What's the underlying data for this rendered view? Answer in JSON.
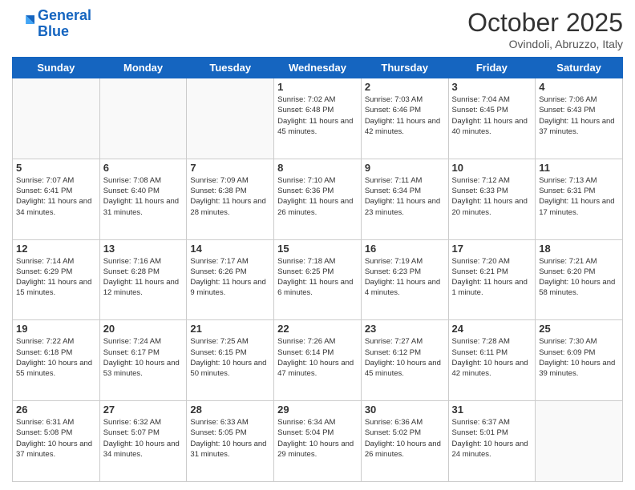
{
  "header": {
    "logo_general": "General",
    "logo_blue": "Blue",
    "month": "October 2025",
    "location": "Ovindoli, Abruzzo, Italy"
  },
  "days_of_week": [
    "Sunday",
    "Monday",
    "Tuesday",
    "Wednesday",
    "Thursday",
    "Friday",
    "Saturday"
  ],
  "weeks": [
    [
      {
        "day": "",
        "sunrise": "",
        "sunset": "",
        "daylight": ""
      },
      {
        "day": "",
        "sunrise": "",
        "sunset": "",
        "daylight": ""
      },
      {
        "day": "",
        "sunrise": "",
        "sunset": "",
        "daylight": ""
      },
      {
        "day": "1",
        "sunrise": "Sunrise: 7:02 AM",
        "sunset": "Sunset: 6:48 PM",
        "daylight": "Daylight: 11 hours and 45 minutes."
      },
      {
        "day": "2",
        "sunrise": "Sunrise: 7:03 AM",
        "sunset": "Sunset: 6:46 PM",
        "daylight": "Daylight: 11 hours and 42 minutes."
      },
      {
        "day": "3",
        "sunrise": "Sunrise: 7:04 AM",
        "sunset": "Sunset: 6:45 PM",
        "daylight": "Daylight: 11 hours and 40 minutes."
      },
      {
        "day": "4",
        "sunrise": "Sunrise: 7:06 AM",
        "sunset": "Sunset: 6:43 PM",
        "daylight": "Daylight: 11 hours and 37 minutes."
      }
    ],
    [
      {
        "day": "5",
        "sunrise": "Sunrise: 7:07 AM",
        "sunset": "Sunset: 6:41 PM",
        "daylight": "Daylight: 11 hours and 34 minutes."
      },
      {
        "day": "6",
        "sunrise": "Sunrise: 7:08 AM",
        "sunset": "Sunset: 6:40 PM",
        "daylight": "Daylight: 11 hours and 31 minutes."
      },
      {
        "day": "7",
        "sunrise": "Sunrise: 7:09 AM",
        "sunset": "Sunset: 6:38 PM",
        "daylight": "Daylight: 11 hours and 28 minutes."
      },
      {
        "day": "8",
        "sunrise": "Sunrise: 7:10 AM",
        "sunset": "Sunset: 6:36 PM",
        "daylight": "Daylight: 11 hours and 26 minutes."
      },
      {
        "day": "9",
        "sunrise": "Sunrise: 7:11 AM",
        "sunset": "Sunset: 6:34 PM",
        "daylight": "Daylight: 11 hours and 23 minutes."
      },
      {
        "day": "10",
        "sunrise": "Sunrise: 7:12 AM",
        "sunset": "Sunset: 6:33 PM",
        "daylight": "Daylight: 11 hours and 20 minutes."
      },
      {
        "day": "11",
        "sunrise": "Sunrise: 7:13 AM",
        "sunset": "Sunset: 6:31 PM",
        "daylight": "Daylight: 11 hours and 17 minutes."
      }
    ],
    [
      {
        "day": "12",
        "sunrise": "Sunrise: 7:14 AM",
        "sunset": "Sunset: 6:29 PM",
        "daylight": "Daylight: 11 hours and 15 minutes."
      },
      {
        "day": "13",
        "sunrise": "Sunrise: 7:16 AM",
        "sunset": "Sunset: 6:28 PM",
        "daylight": "Daylight: 11 hours and 12 minutes."
      },
      {
        "day": "14",
        "sunrise": "Sunrise: 7:17 AM",
        "sunset": "Sunset: 6:26 PM",
        "daylight": "Daylight: 11 hours and 9 minutes."
      },
      {
        "day": "15",
        "sunrise": "Sunrise: 7:18 AM",
        "sunset": "Sunset: 6:25 PM",
        "daylight": "Daylight: 11 hours and 6 minutes."
      },
      {
        "day": "16",
        "sunrise": "Sunrise: 7:19 AM",
        "sunset": "Sunset: 6:23 PM",
        "daylight": "Daylight: 11 hours and 4 minutes."
      },
      {
        "day": "17",
        "sunrise": "Sunrise: 7:20 AM",
        "sunset": "Sunset: 6:21 PM",
        "daylight": "Daylight: 11 hours and 1 minute."
      },
      {
        "day": "18",
        "sunrise": "Sunrise: 7:21 AM",
        "sunset": "Sunset: 6:20 PM",
        "daylight": "Daylight: 10 hours and 58 minutes."
      }
    ],
    [
      {
        "day": "19",
        "sunrise": "Sunrise: 7:22 AM",
        "sunset": "Sunset: 6:18 PM",
        "daylight": "Daylight: 10 hours and 55 minutes."
      },
      {
        "day": "20",
        "sunrise": "Sunrise: 7:24 AM",
        "sunset": "Sunset: 6:17 PM",
        "daylight": "Daylight: 10 hours and 53 minutes."
      },
      {
        "day": "21",
        "sunrise": "Sunrise: 7:25 AM",
        "sunset": "Sunset: 6:15 PM",
        "daylight": "Daylight: 10 hours and 50 minutes."
      },
      {
        "day": "22",
        "sunrise": "Sunrise: 7:26 AM",
        "sunset": "Sunset: 6:14 PM",
        "daylight": "Daylight: 10 hours and 47 minutes."
      },
      {
        "day": "23",
        "sunrise": "Sunrise: 7:27 AM",
        "sunset": "Sunset: 6:12 PM",
        "daylight": "Daylight: 10 hours and 45 minutes."
      },
      {
        "day": "24",
        "sunrise": "Sunrise: 7:28 AM",
        "sunset": "Sunset: 6:11 PM",
        "daylight": "Daylight: 10 hours and 42 minutes."
      },
      {
        "day": "25",
        "sunrise": "Sunrise: 7:30 AM",
        "sunset": "Sunset: 6:09 PM",
        "daylight": "Daylight: 10 hours and 39 minutes."
      }
    ],
    [
      {
        "day": "26",
        "sunrise": "Sunrise: 6:31 AM",
        "sunset": "Sunset: 5:08 PM",
        "daylight": "Daylight: 10 hours and 37 minutes."
      },
      {
        "day": "27",
        "sunrise": "Sunrise: 6:32 AM",
        "sunset": "Sunset: 5:07 PM",
        "daylight": "Daylight: 10 hours and 34 minutes."
      },
      {
        "day": "28",
        "sunrise": "Sunrise: 6:33 AM",
        "sunset": "Sunset: 5:05 PM",
        "daylight": "Daylight: 10 hours and 31 minutes."
      },
      {
        "day": "29",
        "sunrise": "Sunrise: 6:34 AM",
        "sunset": "Sunset: 5:04 PM",
        "daylight": "Daylight: 10 hours and 29 minutes."
      },
      {
        "day": "30",
        "sunrise": "Sunrise: 6:36 AM",
        "sunset": "Sunset: 5:02 PM",
        "daylight": "Daylight: 10 hours and 26 minutes."
      },
      {
        "day": "31",
        "sunrise": "Sunrise: 6:37 AM",
        "sunset": "Sunset: 5:01 PM",
        "daylight": "Daylight: 10 hours and 24 minutes."
      },
      {
        "day": "",
        "sunrise": "",
        "sunset": "",
        "daylight": ""
      }
    ]
  ]
}
